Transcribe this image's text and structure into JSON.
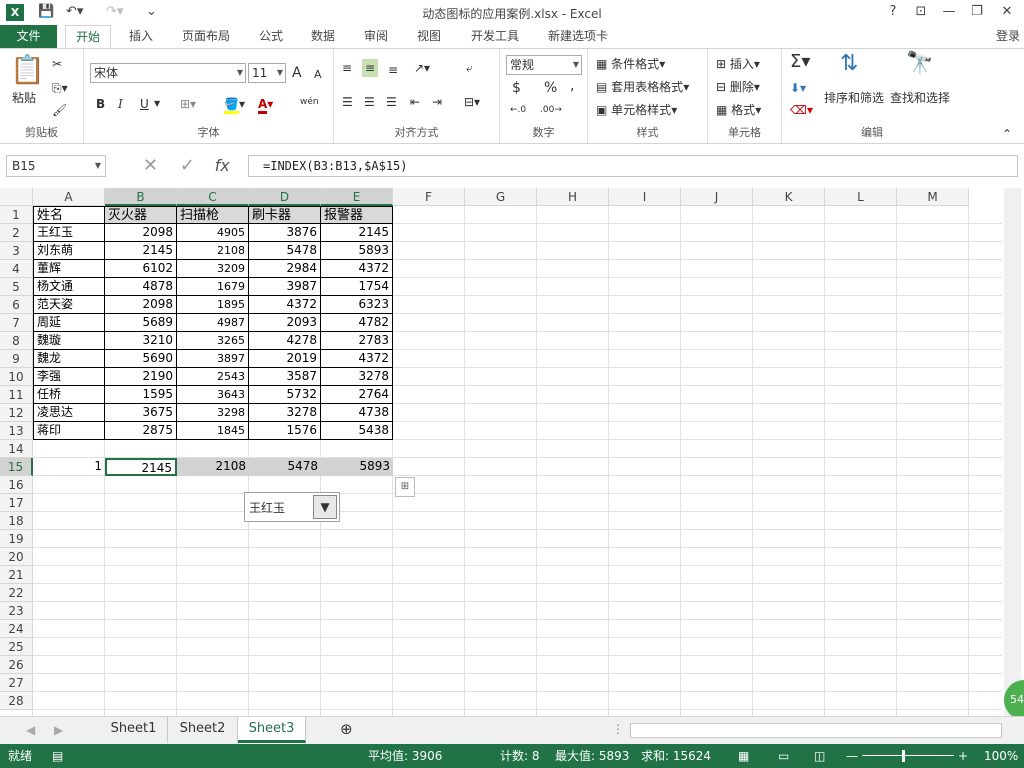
{
  "window": {
    "title": "动态图标的应用案例.xlsx - Excel",
    "login": "登录",
    "help": "?"
  },
  "tabs": [
    "文件",
    "开始",
    "插入",
    "页面布局",
    "公式",
    "数据",
    "审阅",
    "视图",
    "开发工具",
    "新建选项卡"
  ],
  "ribbon": {
    "clipboard": {
      "label": "剪贴板",
      "paste": "粘贴"
    },
    "font": {
      "label": "字体",
      "name": "宋体",
      "size": "11",
      "bold": "B",
      "italic": "I",
      "underline": "U",
      "inc": "A",
      "dec": "A",
      "pinyin": "wén"
    },
    "align": {
      "label": "对齐方式"
    },
    "number": {
      "label": "数字",
      "format": "常规",
      "currency": "$",
      "percent": "%",
      "comma": ","
    },
    "styles": {
      "label": "样式",
      "cond": "条件格式",
      "table": "套用表格格式",
      "cell": "单元格样式"
    },
    "cells": {
      "label": "单元格",
      "insert": "插入",
      "delete": "删除",
      "format": "格式"
    },
    "editing": {
      "label": "编辑",
      "sort": "排序和筛选",
      "find": "查找和选择",
      "sum": "Σ"
    }
  },
  "formula": {
    "namebox": "B15",
    "fx": "fx",
    "content": "=INDEX(B3:B13,$A$15)"
  },
  "columns": [
    "A",
    "B",
    "C",
    "D",
    "E",
    "F",
    "G",
    "H",
    "I",
    "J",
    "K",
    "L",
    "M"
  ],
  "rows": [
    "1",
    "2",
    "3",
    "4",
    "5",
    "6",
    "7",
    "8",
    "9",
    "10",
    "11",
    "12",
    "13",
    "14",
    "15",
    "16",
    "17",
    "18",
    "19",
    "20",
    "21",
    "22",
    "23",
    "24",
    "25",
    "26",
    "27",
    "28"
  ],
  "table": {
    "headers": [
      "姓名",
      "灭火器",
      "扫描枪",
      "刷卡器",
      "报警器"
    ],
    "data": [
      [
        "王红玉",
        "2098",
        "4905",
        "3876",
        "2145"
      ],
      [
        "刘东萌",
        "2145",
        "2108",
        "5478",
        "5893"
      ],
      [
        "董辉",
        "6102",
        "3209",
        "2984",
        "4372"
      ],
      [
        "杨文通",
        "4878",
        "1679",
        "3987",
        "1754"
      ],
      [
        "范天姿",
        "2098",
        "1895",
        "4372",
        "6323"
      ],
      [
        "周延",
        "5689",
        "4987",
        "2093",
        "4782"
      ],
      [
        "魏璇",
        "3210",
        "3265",
        "4278",
        "2783"
      ],
      [
        "魏龙",
        "5690",
        "3897",
        "2019",
        "4372"
      ],
      [
        "李强",
        "2190",
        "2543",
        "3587",
        "3278"
      ],
      [
        "任桥",
        "1595",
        "3643",
        "5732",
        "2764"
      ],
      [
        "凌思达",
        "3675",
        "3298",
        "3278",
        "4738"
      ],
      [
        "蒋印",
        "2875",
        "1845",
        "1576",
        "5438"
      ]
    ],
    "row15": [
      "1",
      "2145",
      "2108",
      "5478",
      "5893"
    ]
  },
  "combo": {
    "value": "王红玉",
    "arrow": "▼"
  },
  "sheets": [
    "Sheet1",
    "Sheet2",
    "Sheet3"
  ],
  "status": {
    "ready": "就绪",
    "avg": "平均值: 3906",
    "count": "计数: 8",
    "max": "最大值: 5893",
    "sum": "求和: 15624",
    "zoom": "100%"
  },
  "bubble": "54"
}
